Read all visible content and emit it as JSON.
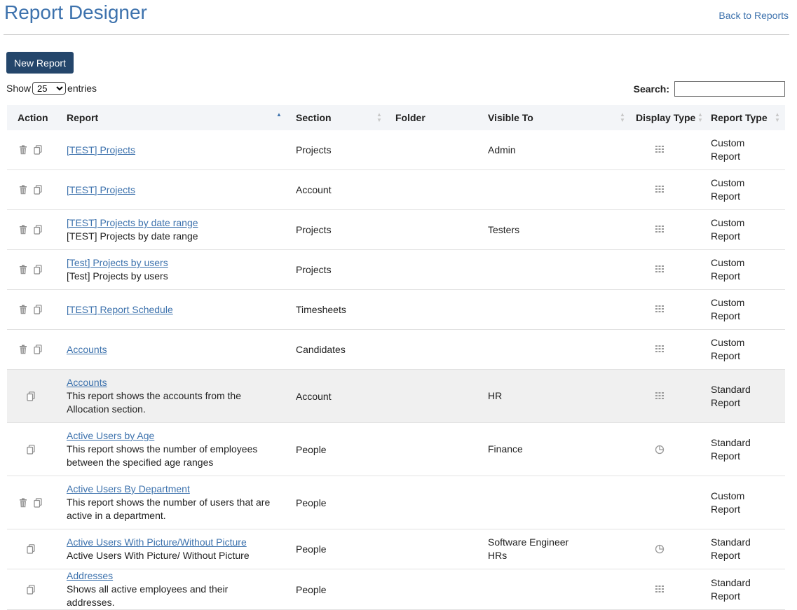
{
  "header": {
    "title": "Report Designer",
    "back_link": "Back to Reports"
  },
  "toolbar": {
    "new_report_label": "New Report"
  },
  "length": {
    "show_label": "Show",
    "entries_label": "entries",
    "selected": "25"
  },
  "search": {
    "label": "Search:",
    "value": ""
  },
  "table": {
    "columns": [
      "Action",
      "Report",
      "Section",
      "Folder",
      "Visible To",
      "Display Type",
      "Report Type"
    ],
    "rows": [
      {
        "report": "[TEST] Projects",
        "desc": "",
        "section": "Projects",
        "folder": "",
        "visible": [
          "Admin"
        ],
        "display": "grid-icon",
        "type": [
          "Custom",
          "Report"
        ],
        "deletable": true
      },
      {
        "report": "[TEST] Projects",
        "desc": "",
        "section": "Account",
        "folder": "",
        "visible": [],
        "display": "grid-icon",
        "type": [
          "Custom",
          "Report"
        ],
        "deletable": true
      },
      {
        "report": "[TEST] Projects by date range",
        "desc": "[TEST] Projects by date range",
        "section": "Projects",
        "folder": "",
        "visible": [
          "Testers"
        ],
        "display": "grid-icon",
        "type": [
          "Custom",
          "Report"
        ],
        "deletable": true
      },
      {
        "report": "[Test] Projects by users",
        "desc": "[Test] Projects by users",
        "section": "Projects",
        "folder": "",
        "visible": [],
        "display": "grid-icon",
        "type": [
          "Custom",
          "Report"
        ],
        "deletable": true
      },
      {
        "report": "[TEST] Report Schedule",
        "desc": "",
        "section": "Timesheets",
        "folder": "",
        "visible": [],
        "display": "grid-icon",
        "type": [
          "Custom",
          "Report"
        ],
        "deletable": true
      },
      {
        "report": "Accounts",
        "desc": "",
        "section": "Candidates",
        "folder": "",
        "visible": [],
        "display": "grid-icon",
        "type": [
          "Custom",
          "Report"
        ],
        "deletable": true
      },
      {
        "report": "Accounts",
        "desc": "This report shows the accounts from the Allocation section.",
        "section": "Account",
        "folder": "",
        "visible": [
          "HR"
        ],
        "display": "grid-icon",
        "type": [
          "Standard",
          "Report"
        ],
        "deletable": false
      },
      {
        "report": "Active Users by Age",
        "desc": "This report shows the number of employees between the specified age ranges",
        "section": "People",
        "folder": "",
        "visible": [
          "Finance"
        ],
        "display": "pie-chart-icon",
        "type": [
          "Standard",
          "Report"
        ],
        "deletable": false
      },
      {
        "report": "Active Users By Department",
        "desc": "This report shows the number of users that are active in a department.",
        "section": "People",
        "folder": "",
        "visible": [],
        "display": "",
        "type": [
          "Custom",
          "Report"
        ],
        "deletable": true
      },
      {
        "report": "Active Users With Picture/Without Picture",
        "desc": "Active Users With Picture/ Without Picture",
        "section": "People",
        "folder": "",
        "visible": [
          "Software Engineer",
          "HRs"
        ],
        "display": "pie-chart-icon",
        "type": [
          "Standard",
          "Report"
        ],
        "deletable": false
      },
      {
        "report": "Addresses",
        "desc": "Shows all active employees and their addresses.",
        "section": "People",
        "folder": "",
        "visible": [],
        "display": "grid-icon",
        "type": [
          "Standard",
          "Report"
        ],
        "deletable": false
      }
    ]
  }
}
